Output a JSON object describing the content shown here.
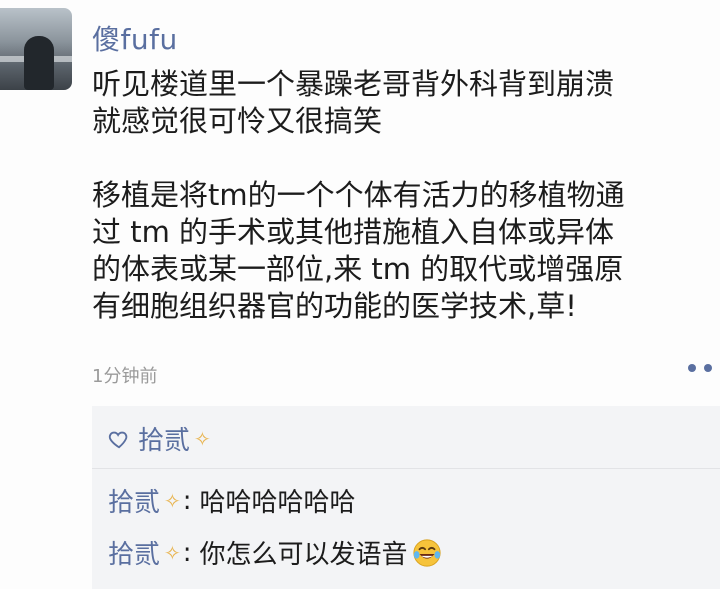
{
  "post": {
    "username": "傻fufu",
    "lines": [
      "听见楼道里一个暴躁老哥背外科背到崩溃",
      "就感觉很可怜又很搞笑",
      "",
      "移植是将tm的一个个体有活力的移植物通",
      "过 tm 的手术或其他措施植入自体或异体",
      "的体表或某一部位,来 tm 的取代或增强原",
      "有细胞组织器官的功能的医学技术,草!"
    ],
    "timestamp": "1分钟前"
  },
  "likes": {
    "names": "拾贰"
  },
  "comments": [
    {
      "name": "拾贰",
      "separator": ":",
      "text": "哈哈哈哈哈哈"
    },
    {
      "name": "拾贰",
      "separator": ":",
      "text": "你怎么可以发语音"
    }
  ],
  "icons": {
    "like": "heart-outline-icon",
    "more": "more-dots-icon",
    "name_deco": "sparkle-decoration-icon",
    "laugh": "laughing-tears-emoji"
  },
  "colors": {
    "link": "#5a6fa0",
    "text": "#1c1c1c",
    "muted": "#9a9a9a",
    "panel": "#f3f4f6"
  }
}
